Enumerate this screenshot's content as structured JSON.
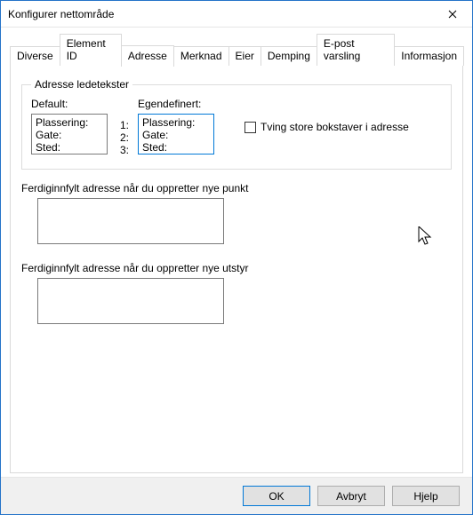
{
  "window": {
    "title": "Konfigurer nettområde"
  },
  "tabs": {
    "diverse": "Diverse",
    "elementid": "Element ID",
    "adresse": "Adresse",
    "merknad": "Merknad",
    "eier": "Eier",
    "demping": "Demping",
    "epost": "E-post varsling",
    "informasjon": "Informasjon"
  },
  "group": {
    "legend": "Adresse ledetekster",
    "defaultLabel": "Default:",
    "customLabel": "Egendefinert:",
    "defaults": {
      "line1": "Plassering:",
      "line2": "Gate:",
      "line3": "Sted:"
    },
    "nums": {
      "n1": "1:",
      "n2": "2:",
      "n3": "3:"
    },
    "custom": {
      "line1": "Plassering:",
      "line2": "Gate:",
      "line3": "Sted:"
    },
    "forceCaps": "Tving store bokstaver i adresse"
  },
  "prefillPunkt": {
    "label": "Ferdiginnfylt adresse når du oppretter nye punkt",
    "value": ""
  },
  "prefillUtstyr": {
    "label": "Ferdiginnfylt adresse når du oppretter nye utstyr",
    "value": ""
  },
  "buttons": {
    "ok": "OK",
    "cancel": "Avbryt",
    "help": "Hjelp"
  }
}
